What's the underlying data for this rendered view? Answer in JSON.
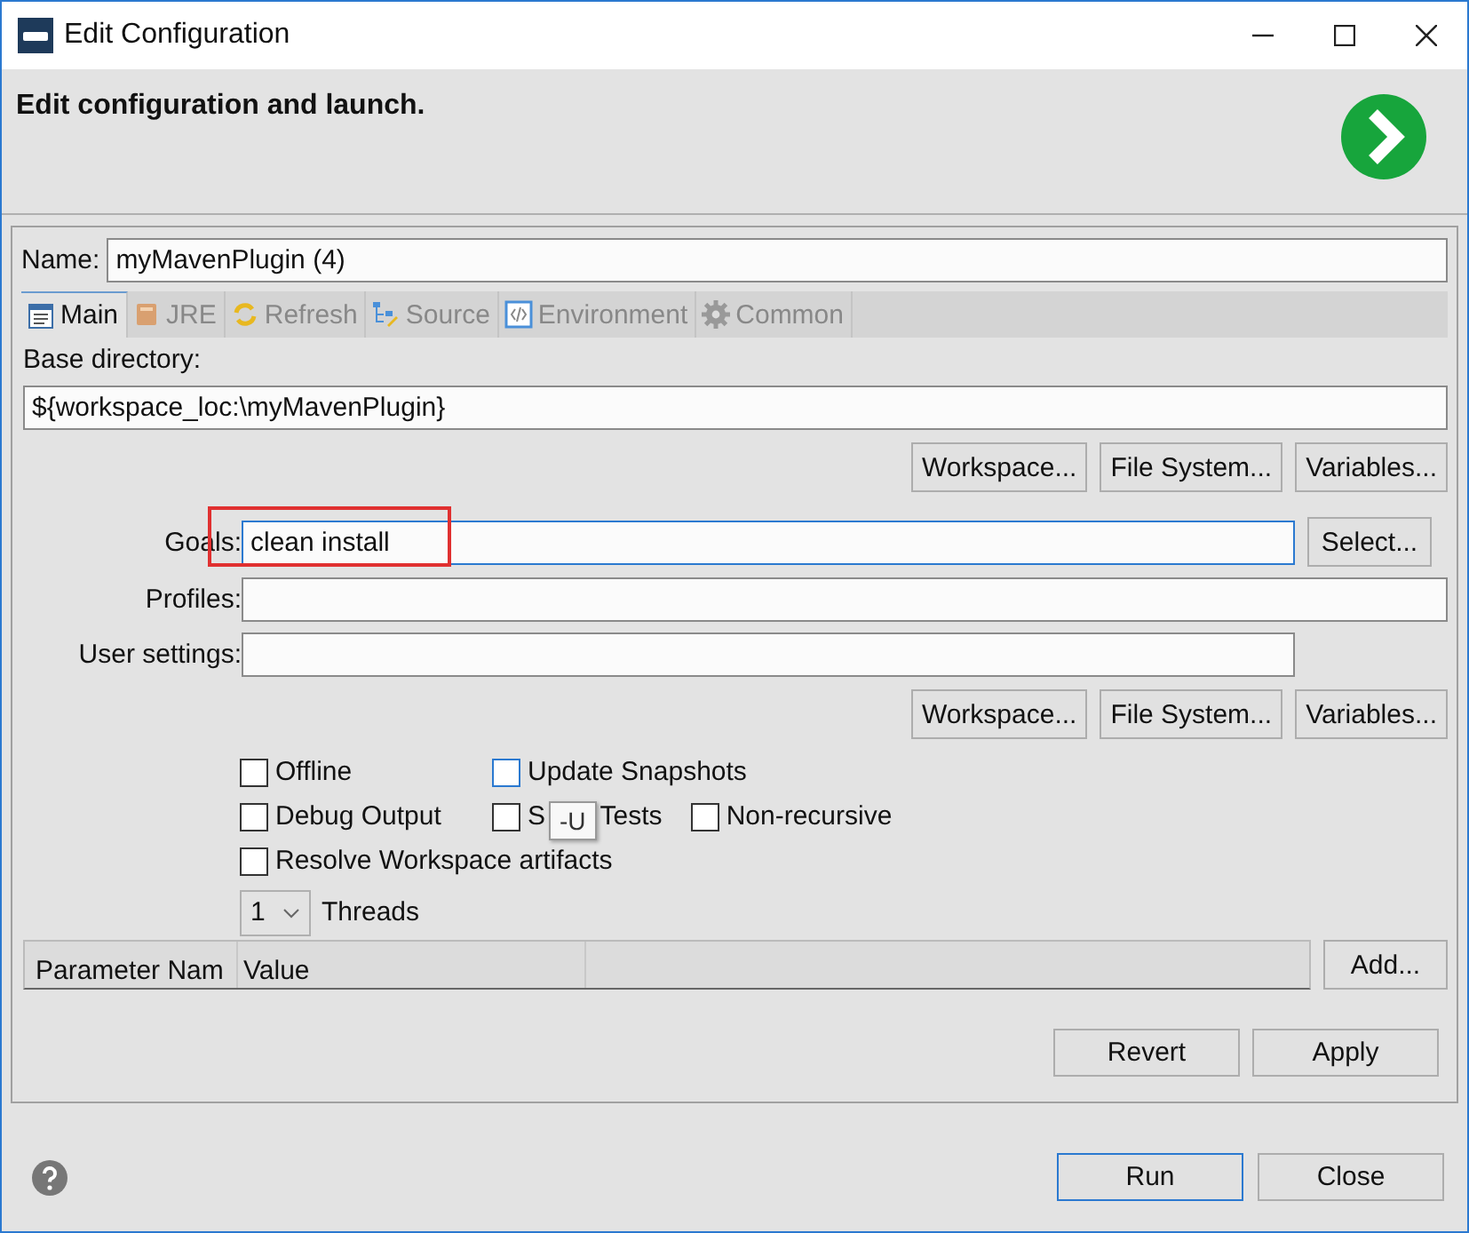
{
  "window": {
    "title": "Edit Configuration"
  },
  "header": {
    "title": "Edit configuration and launch."
  },
  "name_field": {
    "label": "Name:",
    "value": "myMavenPlugin (4)"
  },
  "tabs": [
    {
      "label": "Main",
      "selected": true
    },
    {
      "label": "JRE",
      "selected": false
    },
    {
      "label": "Refresh",
      "selected": false
    },
    {
      "label": "Source",
      "selected": false
    },
    {
      "label": "Environment",
      "selected": false
    },
    {
      "label": "Common",
      "selected": false
    }
  ],
  "base_directory": {
    "label": "Base directory:",
    "value": "${workspace_loc:\\myMavenPlugin}"
  },
  "dir_buttons": [
    "Workspace...",
    "File System...",
    "Variables..."
  ],
  "goals": {
    "label": "Goals:",
    "value": "clean install",
    "button": "Select...",
    "highlighted": true
  },
  "profiles": {
    "label": "Profiles:"
  },
  "user_settings": {
    "label": "User settings:"
  },
  "settings_buttons": [
    "Workspace...",
    "File System...",
    "Variables..."
  ],
  "options": [
    [
      {
        "label": "Offline",
        "checked": false,
        "focused": false
      },
      {
        "label": "Update Snapshots",
        "checked": false,
        "focused": true
      }
    ],
    [
      {
        "label": "Debug Output",
        "checked": false,
        "focused": false
      },
      {
        "label": "S",
        "label_after": "Tests",
        "checked": false,
        "focused": false
      },
      {
        "label": "Non-recursive",
        "checked": false,
        "focused": false
      }
    ],
    [
      {
        "label": "Resolve Workspace artifacts",
        "checked": false,
        "focused": false
      }
    ]
  ],
  "tooltip": "-U",
  "threads": {
    "value": "1",
    "label": "Threads"
  },
  "parameters": {
    "columns": [
      "Parameter Nam",
      "Value"
    ],
    "button": "Add..."
  },
  "panel_buttons": [
    "Revert",
    "Apply"
  ],
  "footer_buttons": [
    {
      "label": "Run",
      "default": true
    },
    {
      "label": "Close",
      "default": false
    }
  ]
}
